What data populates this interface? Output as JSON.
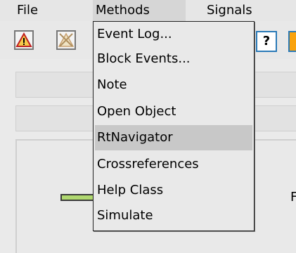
{
  "menubar": {
    "file": "File",
    "methods": "Methods",
    "signals": "Signals"
  },
  "toolbar": {
    "help_label": "?"
  },
  "methods_menu": {
    "items": [
      {
        "label": "Event Log..."
      },
      {
        "label": "Block Events..."
      },
      {
        "label": "Note"
      },
      {
        "label": "Open Object"
      },
      {
        "label": "RtNavigator",
        "highlighted": true
      },
      {
        "label": "Crossreferences"
      },
      {
        "label": "Help Class"
      },
      {
        "label": "Simulate"
      }
    ]
  },
  "content": {
    "partial_label": "F"
  },
  "colors": {
    "accent_blue": "#2a7ab8",
    "orange_button": "#f9a20d",
    "green_bar": "#b0d870",
    "highlight": "#c8c8c8"
  }
}
